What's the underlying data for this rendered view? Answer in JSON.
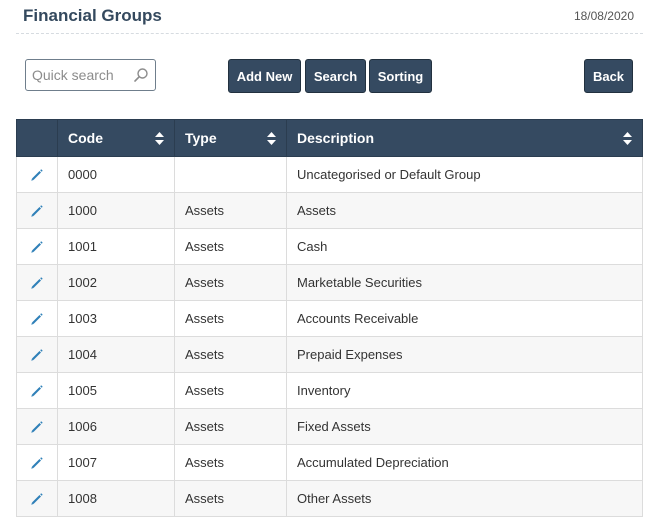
{
  "header": {
    "title": "Financial Groups",
    "date": "18/08/2020"
  },
  "toolbar": {
    "search_placeholder": "Quick search",
    "add_new_label": "Add New",
    "search_label": "Search",
    "sorting_label": "Sorting",
    "back_label": "Back"
  },
  "table": {
    "columns": [
      "Code",
      "Type",
      "Description"
    ],
    "rows": [
      {
        "code": "0000",
        "type": "",
        "description": "Uncategorised or Default Group"
      },
      {
        "code": "1000",
        "type": "Assets",
        "description": "Assets"
      },
      {
        "code": "1001",
        "type": "Assets",
        "description": "Cash"
      },
      {
        "code": "1002",
        "type": "Assets",
        "description": "Marketable Securities"
      },
      {
        "code": "1003",
        "type": "Assets",
        "description": "Accounts Receivable"
      },
      {
        "code": "1004",
        "type": "Assets",
        "description": "Prepaid Expenses"
      },
      {
        "code": "1005",
        "type": "Assets",
        "description": "Inventory"
      },
      {
        "code": "1006",
        "type": "Assets",
        "description": "Fixed Assets"
      },
      {
        "code": "1007",
        "type": "Assets",
        "description": "Accumulated Depreciation"
      },
      {
        "code": "1008",
        "type": "Assets",
        "description": "Other Assets"
      }
    ]
  },
  "icons": {
    "edit": "pencil-icon",
    "sort": "sort-arrows-icon",
    "search": "magnifier-icon"
  },
  "colors": {
    "header_bg": "#354a61",
    "button_bg": "#354a61",
    "edit_icon": "#2f80b8",
    "title": "#34495e"
  }
}
